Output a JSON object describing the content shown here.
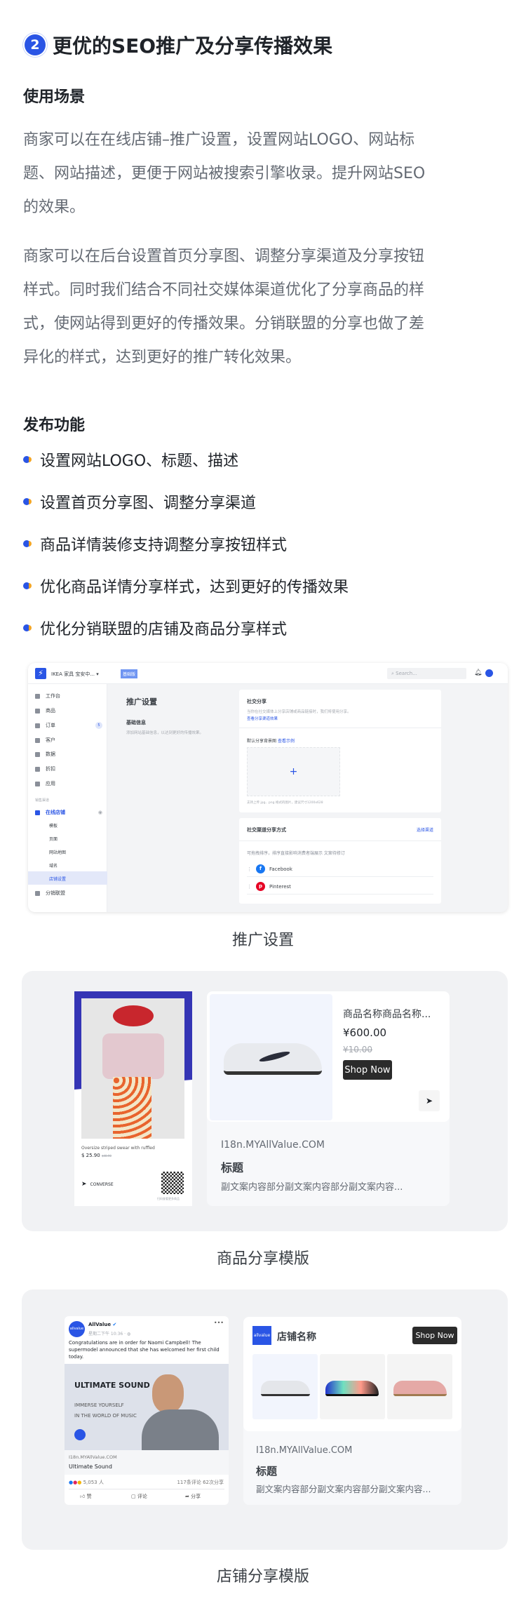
{
  "section": {
    "number": "2",
    "title": "更优的SEO推广及分享传播效果"
  },
  "usage": {
    "heading": "使用场景",
    "paragraphs": [
      [
        "商家可以在在线店铺–推广设置，设置网站LOGO、网站标",
        "题、网站描述，更便于网站被搜索引擎收录。提升网站SEO",
        "的效果。"
      ],
      [
        "商家可以在后台设置首页分享图、调整分享渠道及分享按钮",
        "样式。同时我们结合不同社交媒体渠道优化了分享商品的样",
        "式，使网站得到更好的传播效果。分销联盟的分享也做了差",
        "异化的样式，达到更好的推广转化效果。"
      ]
    ]
  },
  "features": {
    "heading": "发布功能",
    "items": [
      "设置网站LOGO、标题、描述",
      "设置首页分享图、调整分享渠道",
      "商品详情装修支持调整分享按钮样式",
      "优化商品详情分享样式，达到更好的传播效果",
      "优化分销联盟的店铺及商品分享样式"
    ]
  },
  "admin": {
    "store_name": "IKEA 家具 宝安中...",
    "plan_badge": "基础版",
    "search_placeholder": "Search...",
    "nav": [
      {
        "label": "工作台"
      },
      {
        "label": "商品"
      },
      {
        "label": "订单",
        "badge": "5"
      },
      {
        "label": "客户"
      },
      {
        "label": "数据"
      },
      {
        "label": "折扣"
      },
      {
        "label": "应用"
      }
    ],
    "channel_heading": "销售渠道",
    "online_store": "在线店铺",
    "sub_nav": [
      "模板",
      "页面",
      "网站地图",
      "域名",
      "店铺设置"
    ],
    "affiliate": "分销联盟",
    "page_title": "推广设置",
    "basic_title": "基础信息",
    "basic_desc": "添加网站基础信息，以达到更好的传播效果。",
    "social": {
      "title": "社交分享",
      "desc": "当你在社交媒体上分享店铺或商品链接时，我们将使用分享。",
      "link": "查看分享渠道效果",
      "bg_label": "默认分享背景图",
      "bg_link": "查看示例",
      "hint": "支持上传 jpg、png 格式的图片，建议尺寸1200x628"
    },
    "channels": {
      "title": "社交渠道分享方式",
      "action": "选择渠道",
      "desc": "可拖拽排序，排序直接影响消费者端展示 文案待修订",
      "items": [
        "Facebook",
        "Pinterest"
      ]
    },
    "caption": "推广设置"
  },
  "product_share": {
    "poster": {
      "product": "Oversize striped swear with ruffled",
      "price": "$ 25.90",
      "old_price": "$40.90",
      "brand": "CONVERSE",
      "qr_hint": "扫码查看更多商品"
    },
    "card": {
      "name": "商品名称商品名称...",
      "price": "¥600.00",
      "old_price": "¥10.00",
      "button": "Shop Now",
      "url": "I18n.MYAllValue.COM",
      "title": "标题",
      "subtitle": "副文案内容部分副文案内容部分副文案内容..."
    },
    "caption": "商品分享模版"
  },
  "store_share": {
    "fb": {
      "page": "AllValue",
      "time": "星期二下午 10:36 · ",
      "text": "Congratulations are in order for Naomi Campbell! The supermodel announced that she has welcomed her first child today.",
      "ad_title": "ULTIMATE SOUND",
      "ad_line1": "IMMERSE YOURSELF",
      "ad_line2": "IN THE WORLD OF MUSIC",
      "url": "I18n.MYAllValue.COM",
      "link_title": "Ultimate Sound",
      "reactions": "5,053 人",
      "comments": "117条评论",
      "shares": "62次分享",
      "like": "赞",
      "comment": "评论",
      "share": "分享",
      "logo": "allvalue"
    },
    "card": {
      "store_name": "店铺名称",
      "button": "Shop Now",
      "url": "I18n.MYAllValue.COM",
      "title": "标题",
      "subtitle": "副文案内容部分副文案内容部分副文案内容...",
      "logo": "allvalue"
    },
    "caption": "店铺分享模版"
  },
  "colors": {
    "accent": "#2a55e5",
    "bullet_tail": "#f5a623",
    "facebook": "#1877f2",
    "pinterest": "#e60023",
    "poster": "#3535b5"
  }
}
